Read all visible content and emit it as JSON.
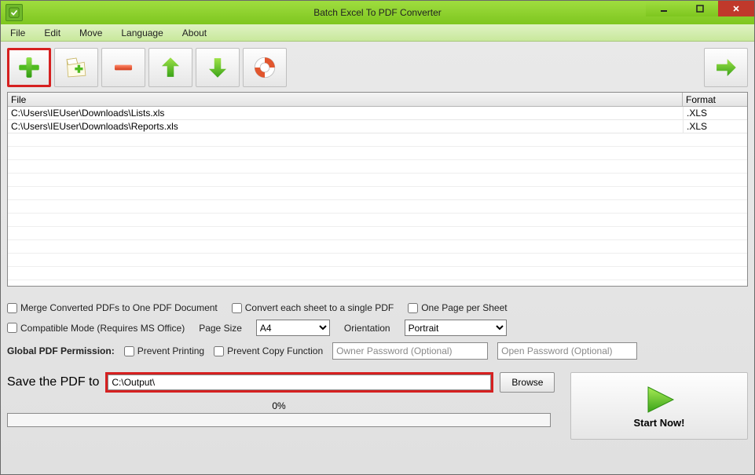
{
  "window": {
    "title": "Batch Excel To PDF Converter"
  },
  "menu": {
    "file": "File",
    "edit": "Edit",
    "move": "Move",
    "language": "Language",
    "about": "About"
  },
  "filelist": {
    "head_file": "File",
    "head_fmt": "Format",
    "rows": [
      {
        "file": "C:\\Users\\IEUser\\Downloads\\Lists.xls",
        "fmt": ".XLS"
      },
      {
        "file": "C:\\Users\\IEUser\\Downloads\\Reports.xls",
        "fmt": ".XLS"
      }
    ]
  },
  "opts": {
    "merge": "Merge Converted PDFs to One PDF Document",
    "each_sheet": "Convert each sheet to a single PDF",
    "one_page": "One Page per Sheet",
    "compat": "Compatible Mode (Requires MS Office)",
    "page_size_label": "Page Size",
    "page_size_value": "A4",
    "orient_label": "Orientation",
    "orient_value": "Portrait"
  },
  "perm": {
    "heading": "Global PDF Permission:",
    "prevent_print": "Prevent Printing",
    "prevent_copy": "Prevent Copy Function",
    "owner_ph": "Owner Password (Optional)",
    "open_ph": "Open Password (Optional)"
  },
  "save": {
    "label": "Save the PDF to",
    "path": "C:\\Output\\",
    "browse": "Browse"
  },
  "progress": {
    "pct_label": "0%"
  },
  "start": {
    "label": "Start Now!"
  }
}
